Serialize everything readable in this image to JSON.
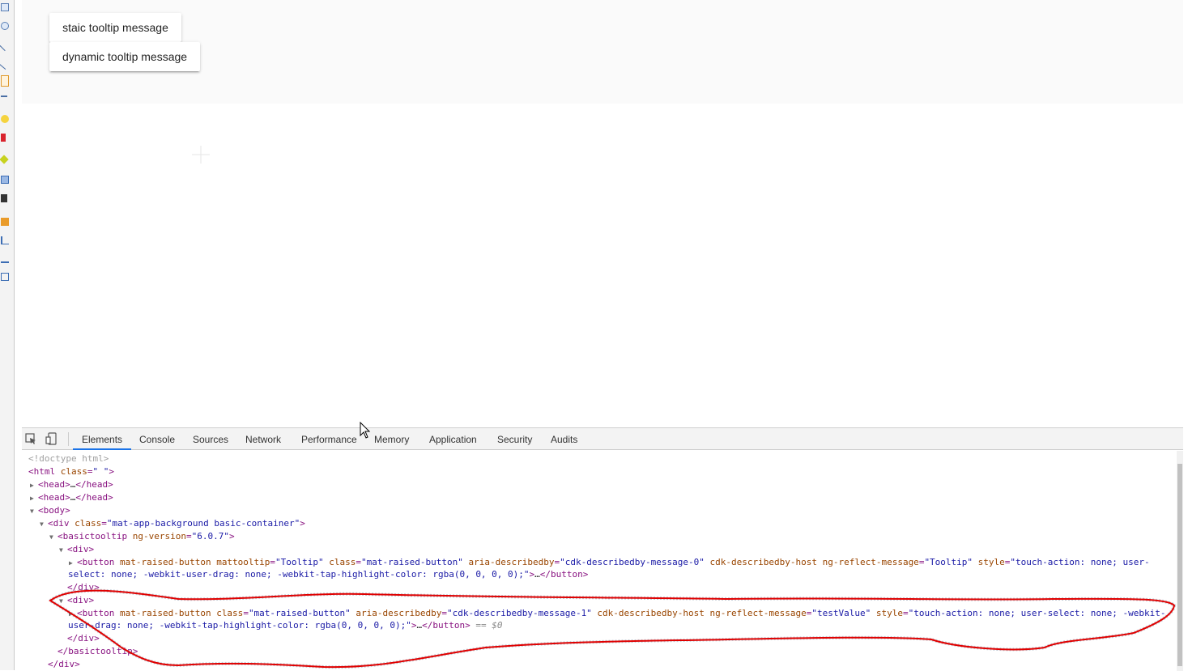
{
  "page": {
    "buttons": [
      {
        "label": "staic tooltip message"
      },
      {
        "label": "dynamic tooltip message"
      }
    ]
  },
  "devtools": {
    "active_tab": "Elements",
    "tabs": [
      "Elements",
      "Console",
      "Sources",
      "Network",
      "Performance",
      "Memory",
      "Application",
      "Security",
      "Audits"
    ],
    "dom_lines": [
      {
        "parts": [
          {
            "c": "cm",
            "t": "<!doctype html>"
          }
        ]
      },
      {
        "parts": [
          {
            "c": "t",
            "t": "<html "
          },
          {
            "c": "an",
            "t": "class"
          },
          {
            "c": "t",
            "t": "="
          },
          {
            "c": "av",
            "t": "\" \""
          },
          {
            "c": "t",
            "t": ">"
          }
        ]
      },
      {
        "parts": [
          {
            "c": "t",
            "t": "<head>"
          },
          {
            "c": "pl",
            "t": "…"
          },
          {
            "c": "t",
            "t": "</head>"
          }
        ]
      },
      {
        "parts": [
          {
            "c": "t",
            "t": "<head>"
          },
          {
            "c": "pl",
            "t": "…"
          },
          {
            "c": "t",
            "t": "</head>"
          }
        ]
      },
      {
        "parts": [
          {
            "c": "t",
            "t": "<body>"
          }
        ]
      },
      {
        "parts": [
          {
            "c": "t",
            "t": "<div "
          },
          {
            "c": "an",
            "t": "class"
          },
          {
            "c": "t",
            "t": "="
          },
          {
            "c": "av",
            "t": "\"mat-app-background basic-container\""
          },
          {
            "c": "t",
            "t": ">"
          }
        ]
      },
      {
        "parts": [
          {
            "c": "t",
            "t": "<basictooltip "
          },
          {
            "c": "an",
            "t": "ng-version"
          },
          {
            "c": "t",
            "t": "="
          },
          {
            "c": "av",
            "t": "\"6.0.7\""
          },
          {
            "c": "t",
            "t": ">"
          }
        ]
      },
      {
        "parts": [
          {
            "c": "t",
            "t": "<div>"
          }
        ]
      },
      {
        "parts": [
          {
            "c": "t",
            "t": "<button "
          },
          {
            "c": "an",
            "t": "mat-raised-button mattooltip"
          },
          {
            "c": "t",
            "t": "="
          },
          {
            "c": "av",
            "t": "\"Tooltip\""
          },
          {
            "c": "an",
            "t": " class"
          },
          {
            "c": "t",
            "t": "="
          },
          {
            "c": "av",
            "t": "\"mat-raised-button\""
          },
          {
            "c": "an",
            "t": " aria-describedby"
          },
          {
            "c": "t",
            "t": "="
          },
          {
            "c": "av",
            "t": "\"cdk-describedby-message-0\""
          },
          {
            "c": "an",
            "t": " cdk-describedby-host ng-reflect-message"
          },
          {
            "c": "t",
            "t": "="
          },
          {
            "c": "av",
            "t": "\"Tooltip\""
          },
          {
            "c": "an",
            "t": " style"
          },
          {
            "c": "t",
            "t": "="
          },
          {
            "c": "av",
            "t": "\"touch-action: none; user-"
          }
        ]
      },
      {
        "parts": [
          {
            "c": "av",
            "t": "select: none; -webkit-user-drag: none; -webkit-tap-highlight-color: rgba(0, 0, 0, 0);\""
          },
          {
            "c": "t",
            "t": ">"
          },
          {
            "c": "pl",
            "t": "…"
          },
          {
            "c": "t",
            "t": "</button>"
          }
        ]
      },
      {
        "parts": [
          {
            "c": "t",
            "t": "</div>"
          }
        ]
      },
      {
        "parts": [
          {
            "c": "t",
            "t": "<div>"
          }
        ]
      },
      {
        "parts": [
          {
            "c": "t",
            "t": "<button "
          },
          {
            "c": "an",
            "t": "mat-raised-button class"
          },
          {
            "c": "t",
            "t": "="
          },
          {
            "c": "av",
            "t": "\"mat-raised-button\""
          },
          {
            "c": "an",
            "t": " aria-describedby"
          },
          {
            "c": "t",
            "t": "="
          },
          {
            "c": "av",
            "t": "\"cdk-describedby-message-1\""
          },
          {
            "c": "an",
            "t": " cdk-describedby-host ng-reflect-message"
          },
          {
            "c": "t",
            "t": "="
          },
          {
            "c": "av",
            "t": "\"testValue\""
          },
          {
            "c": "an",
            "t": " style"
          },
          {
            "c": "t",
            "t": "="
          },
          {
            "c": "av",
            "t": "\"touch-action: none; user-select: none; -webkit-"
          }
        ]
      },
      {
        "parts": [
          {
            "c": "av",
            "t": "user-drag: none; -webkit-tap-highlight-color: rgba(0, 0, 0, 0);\""
          },
          {
            "c": "t",
            "t": ">"
          },
          {
            "c": "pl",
            "t": "…"
          },
          {
            "c": "t",
            "t": "</button>"
          },
          {
            "c": "dim",
            "t": " == $0"
          }
        ]
      },
      {
        "parts": [
          {
            "c": "t",
            "t": "</div>"
          }
        ]
      },
      {
        "parts": [
          {
            "c": "t",
            "t": "</basictooltip>"
          }
        ]
      },
      {
        "parts": [
          {
            "c": "t",
            "t": "</div>"
          }
        ]
      }
    ]
  },
  "colors": {
    "annotation_stroke": "#e00000",
    "selection": "#cfe8fc",
    "active_tab_underline": "#1a73e8"
  },
  "icons": [
    "inspect-element-icon",
    "device-toolbar-icon",
    "mouse-cursor-icon",
    "crosshair-icon"
  ]
}
